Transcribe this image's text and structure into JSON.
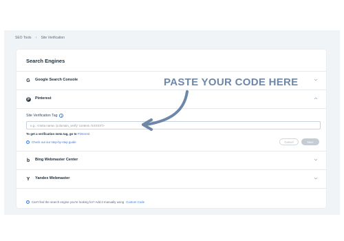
{
  "breadcrumb": {
    "items": [
      "SEO Tools",
      "Site Verification"
    ],
    "separator": "›"
  },
  "panel": {
    "title": "Search Engines"
  },
  "engines": [
    {
      "name": "Google Search Console",
      "icon": "google-icon",
      "icon_glyph": "G",
      "expanded": false
    },
    {
      "name": "Pinterest",
      "icon": "pinterest-icon",
      "icon_glyph": "P",
      "expanded": true
    },
    {
      "name": "Bing Webmaster Center",
      "icon": "bing-icon",
      "icon_glyph": "b",
      "expanded": false
    },
    {
      "name": "Yandex Webmaster",
      "icon": "yandex-icon",
      "icon_glyph": "Y",
      "expanded": false
    }
  ],
  "pinterest_form": {
    "field_label": "Site Verification Tag",
    "info_glyph": "i",
    "placeholder": "e.g., <meta name='p:domain_verify' content='XXXXX'/>",
    "hint_text": "To get a verification meta tag, go to",
    "hint_link": "Pinterest",
    "guide_text": "Check out our step-by-step guide",
    "guide_glyph": "?",
    "cancel_label": "Cancel",
    "save_label": "Save"
  },
  "footer": {
    "text": "Can't find the search engine you're looking for? Add it manually using",
    "link": "Custom Code",
    "glyph": "?"
  },
  "overlay": {
    "text": "PASTE YOUR CODE HERE",
    "color": "#6c87a8"
  },
  "colors": {
    "accent": "#3b7bd6",
    "background": "#f0f4f7"
  }
}
